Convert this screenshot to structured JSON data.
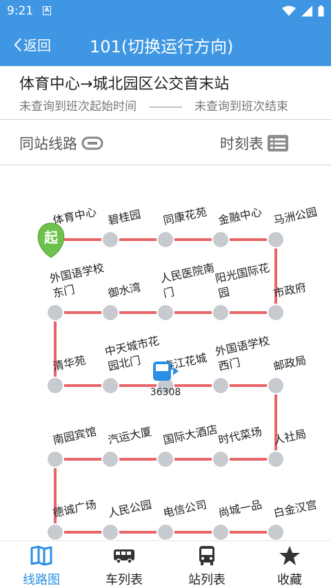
{
  "status_bar": {
    "time": "9:21",
    "badge": "A"
  },
  "app_bar": {
    "back_label": "返回",
    "title": "101(切换运行方向)"
  },
  "route": {
    "name": "体育中心→城北园区公交首末站",
    "start_time": "未查询到班次起始时间",
    "end_time": "未查询到班次结束"
  },
  "actions": {
    "same_station_routes": "同站线路",
    "timetable": "时刻表"
  },
  "map": {
    "start_badge": "起",
    "bus_number": "36308",
    "accent_color": "#e86567",
    "stop_color": "#c7cbcf",
    "stations": [
      [
        "体育中心"
      ],
      [
        "碧桂园"
      ],
      [
        "同康花苑"
      ],
      [
        "金融中心"
      ],
      [
        "马洲公园"
      ],
      [
        "市政府"
      ],
      [
        "阳光国际花",
        "园"
      ],
      [
        "人民医院南",
        "门"
      ],
      [
        "御水湾"
      ],
      [
        "外国语学校",
        "东门"
      ],
      [
        "清华苑"
      ],
      [
        "中天城市花",
        "园北门"
      ],
      [
        "春江花城"
      ],
      [
        "外国语学校",
        "西门"
      ],
      [
        "邮政局"
      ],
      [
        "人社局"
      ],
      [
        "时代菜场"
      ],
      [
        "国际大酒店"
      ],
      [
        "汽运大厦"
      ],
      [
        "南园宾馆"
      ],
      [
        "德诚广场"
      ],
      [
        "人民公园"
      ],
      [
        "电信公司"
      ],
      [
        "尚城一品"
      ],
      [
        "白金汉宫"
      ]
    ]
  },
  "bottom_nav": [
    {
      "label": "线路图",
      "icon": "map-book-icon",
      "active": true
    },
    {
      "label": "车列表",
      "icon": "bus-side-icon",
      "active": false
    },
    {
      "label": "站列表",
      "icon": "bus-front-icon",
      "active": false
    },
    {
      "label": "收藏",
      "icon": "star-icon",
      "active": false
    }
  ]
}
